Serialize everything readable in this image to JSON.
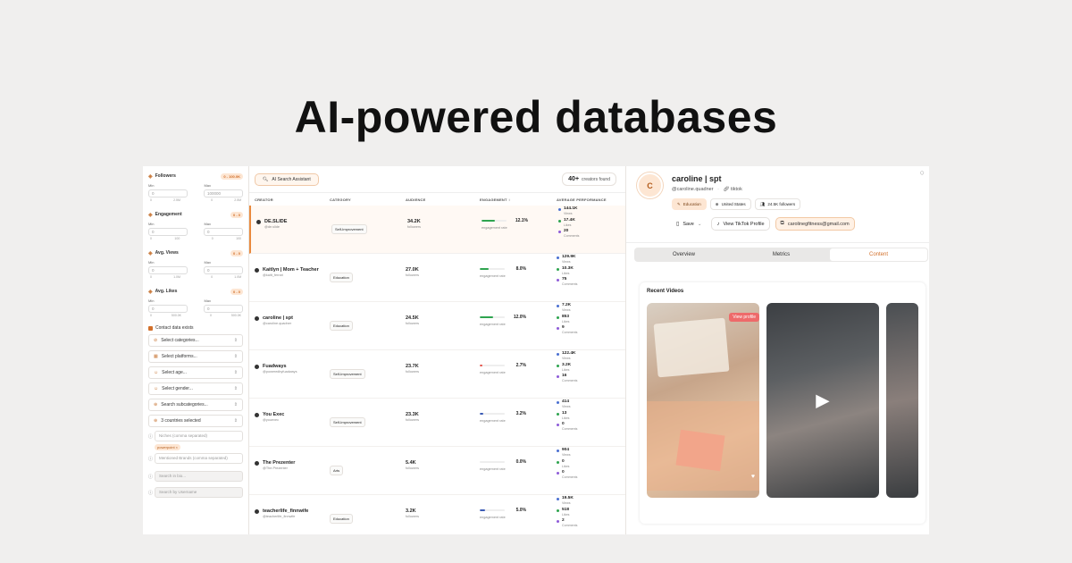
{
  "headline": "AI-powered databases",
  "filters": {
    "groups": [
      {
        "label": "Followers",
        "tag": "0 - 100.0K",
        "min_label": "Min",
        "max_label": "Max",
        "min_value": "0",
        "max_value": "100000",
        "scale": [
          "0",
          "2.5M",
          "0",
          "2.5M"
        ]
      },
      {
        "label": "Engagement",
        "tag": "0 - 0",
        "min_label": "Min",
        "max_label": "Max",
        "min_value": "0",
        "max_value": "0",
        "scale": [
          "0",
          "100",
          "0",
          "100"
        ]
      },
      {
        "label": "Avg. Views",
        "tag": "0 - 0",
        "min_label": "Min",
        "max_label": "Max",
        "min_value": "0",
        "max_value": "0",
        "scale": [
          "0",
          "1.0M",
          "0",
          "1.0M"
        ]
      },
      {
        "label": "Avg. Likes",
        "tag": "0 - 0",
        "min_label": "Min",
        "max_label": "Max",
        "min_value": "0",
        "max_value": "0",
        "scale": [
          "0",
          "500.0K",
          "0",
          "500.0K"
        ]
      }
    ],
    "contact_label": "Contact data exists",
    "selects": [
      "Select categories...",
      "Select platforms...",
      "Select age...",
      "Select gender...",
      "Search subcategories...",
      "3 countries selected"
    ],
    "niches_placeholder": "Niches (comma separated)",
    "chip": "powerpoint ×",
    "brands_placeholder": "Mentioned Brands (comma separated)",
    "bio_placeholder": "Search in bio...",
    "username_placeholder": "Search by Username"
  },
  "table": {
    "ai_button": "AI Search Assistant",
    "found_count": "40+",
    "found_label": "creators found",
    "headers": [
      "CREATOR",
      "CATEGORY",
      "AUDIENCE",
      "ENGAGEMENT ↕",
      "AVERAGE PERFORMANCE"
    ],
    "rows": [
      {
        "name": "DE.SLIDE",
        "handle": "@de.slide",
        "category": "Self-Improvement",
        "audience": "34.2K",
        "audience_label": "followers",
        "engagement": "12.1%",
        "engagement_fraction": 0.55,
        "engagement_color": "#2ea44f",
        "engagement_label": "engagement rate",
        "perf": [
          {
            "v": "144.1K",
            "l": "Views",
            "c": "#4a6fd1"
          },
          {
            "v": "17.4K",
            "l": "Likes",
            "c": "#2ea44f"
          },
          {
            "v": "20",
            "l": "Comments",
            "c": "#8e5bd8"
          }
        ]
      },
      {
        "name": "Kaitlyn | Mom + Teacher",
        "handle": "@kaitt_ferrari",
        "category": "Education",
        "audience": "27.0K",
        "audience_label": "followers",
        "engagement": "8.0%",
        "engagement_fraction": 0.35,
        "engagement_color": "#2ea44f",
        "engagement_label": "engagement rate",
        "perf": [
          {
            "v": "129.9K",
            "l": "Views",
            "c": "#4a6fd1"
          },
          {
            "v": "10.3K",
            "l": "Likes",
            "c": "#2ea44f"
          },
          {
            "v": "75",
            "l": "Comments",
            "c": "#8e5bd8"
          }
        ]
      },
      {
        "name": "caroline | spt",
        "handle": "@caroline.quadner",
        "category": "Education",
        "audience": "24.5K",
        "audience_label": "followers",
        "engagement": "12.0%",
        "engagement_fraction": 0.55,
        "engagement_color": "#2ea44f",
        "engagement_label": "engagement rate",
        "perf": [
          {
            "v": "7.2K",
            "l": "Views",
            "c": "#4a6fd1"
          },
          {
            "v": "853",
            "l": "Likes",
            "c": "#2ea44f"
          },
          {
            "v": "9",
            "l": "Comments",
            "c": "#8e5bd8"
          }
        ]
      },
      {
        "name": "Fuadways",
        "handle": "@poweredbyfuadways",
        "category": "Self-Improvement",
        "audience": "23.7K",
        "audience_label": "followers",
        "engagement": "2.7%",
        "engagement_fraction": 0.12,
        "engagement_color": "#e5534b",
        "engagement_label": "engagement rate",
        "perf": [
          {
            "v": "122.4K",
            "l": "Views",
            "c": "#4a6fd1"
          },
          {
            "v": "3.2K",
            "l": "Likes",
            "c": "#2ea44f"
          },
          {
            "v": "16",
            "l": "Comments",
            "c": "#8e5bd8"
          }
        ]
      },
      {
        "name": "You Exec",
        "handle": "@youexec",
        "category": "Self-Improvement",
        "audience": "23.3K",
        "audience_label": "followers",
        "engagement": "3.2%",
        "engagement_fraction": 0.15,
        "engagement_color": "#3b5bb5",
        "engagement_label": "engagement rate",
        "perf": [
          {
            "v": "414",
            "l": "Views",
            "c": "#4a6fd1"
          },
          {
            "v": "13",
            "l": "Likes",
            "c": "#2ea44f"
          },
          {
            "v": "0",
            "l": "Comments",
            "c": "#8e5bd8"
          }
        ]
      },
      {
        "name": "The Prezenter",
        "handle": "@The.Prezenter",
        "category": "Arts",
        "audience": "5.4K",
        "audience_label": "followers",
        "engagement": "0.0%",
        "engagement_fraction": 0.0,
        "engagement_color": "#3b5bb5",
        "engagement_label": "engagement rate",
        "perf": [
          {
            "v": "904",
            "l": "Views",
            "c": "#4a6fd1"
          },
          {
            "v": "0",
            "l": "Likes",
            "c": "#2ea44f"
          },
          {
            "v": "0",
            "l": "Comments",
            "c": "#8e5bd8"
          }
        ]
      },
      {
        "name": "teacherlife_finnwife",
        "handle": "@teacherlife_finnwife",
        "category": "Education",
        "audience": "3.2K",
        "audience_label": "followers",
        "engagement": "5.0%",
        "engagement_fraction": 0.22,
        "engagement_color": "#3b5bb5",
        "engagement_label": "engagement rate",
        "perf": [
          {
            "v": "19.5K",
            "l": "Views",
            "c": "#4a6fd1"
          },
          {
            "v": "518",
            "l": "Likes",
            "c": "#2ea44f"
          },
          {
            "v": "2",
            "l": "Comments",
            "c": "#8e5bd8"
          }
        ]
      }
    ]
  },
  "profile": {
    "avatar_letter": "C",
    "name": "caroline | spt",
    "handle": "@caroline.quadner",
    "platform": "tiktok",
    "tags": [
      "Education",
      "United States",
      "24.5K followers"
    ],
    "save_label": "Save",
    "view_label": "View TikTok Profile",
    "email": "carolinegfitness@gmail.com",
    "tabs": [
      "Overview",
      "Metrics",
      "Content"
    ],
    "recent_title": "Recent Videos",
    "view_profile_label": "View profile"
  }
}
